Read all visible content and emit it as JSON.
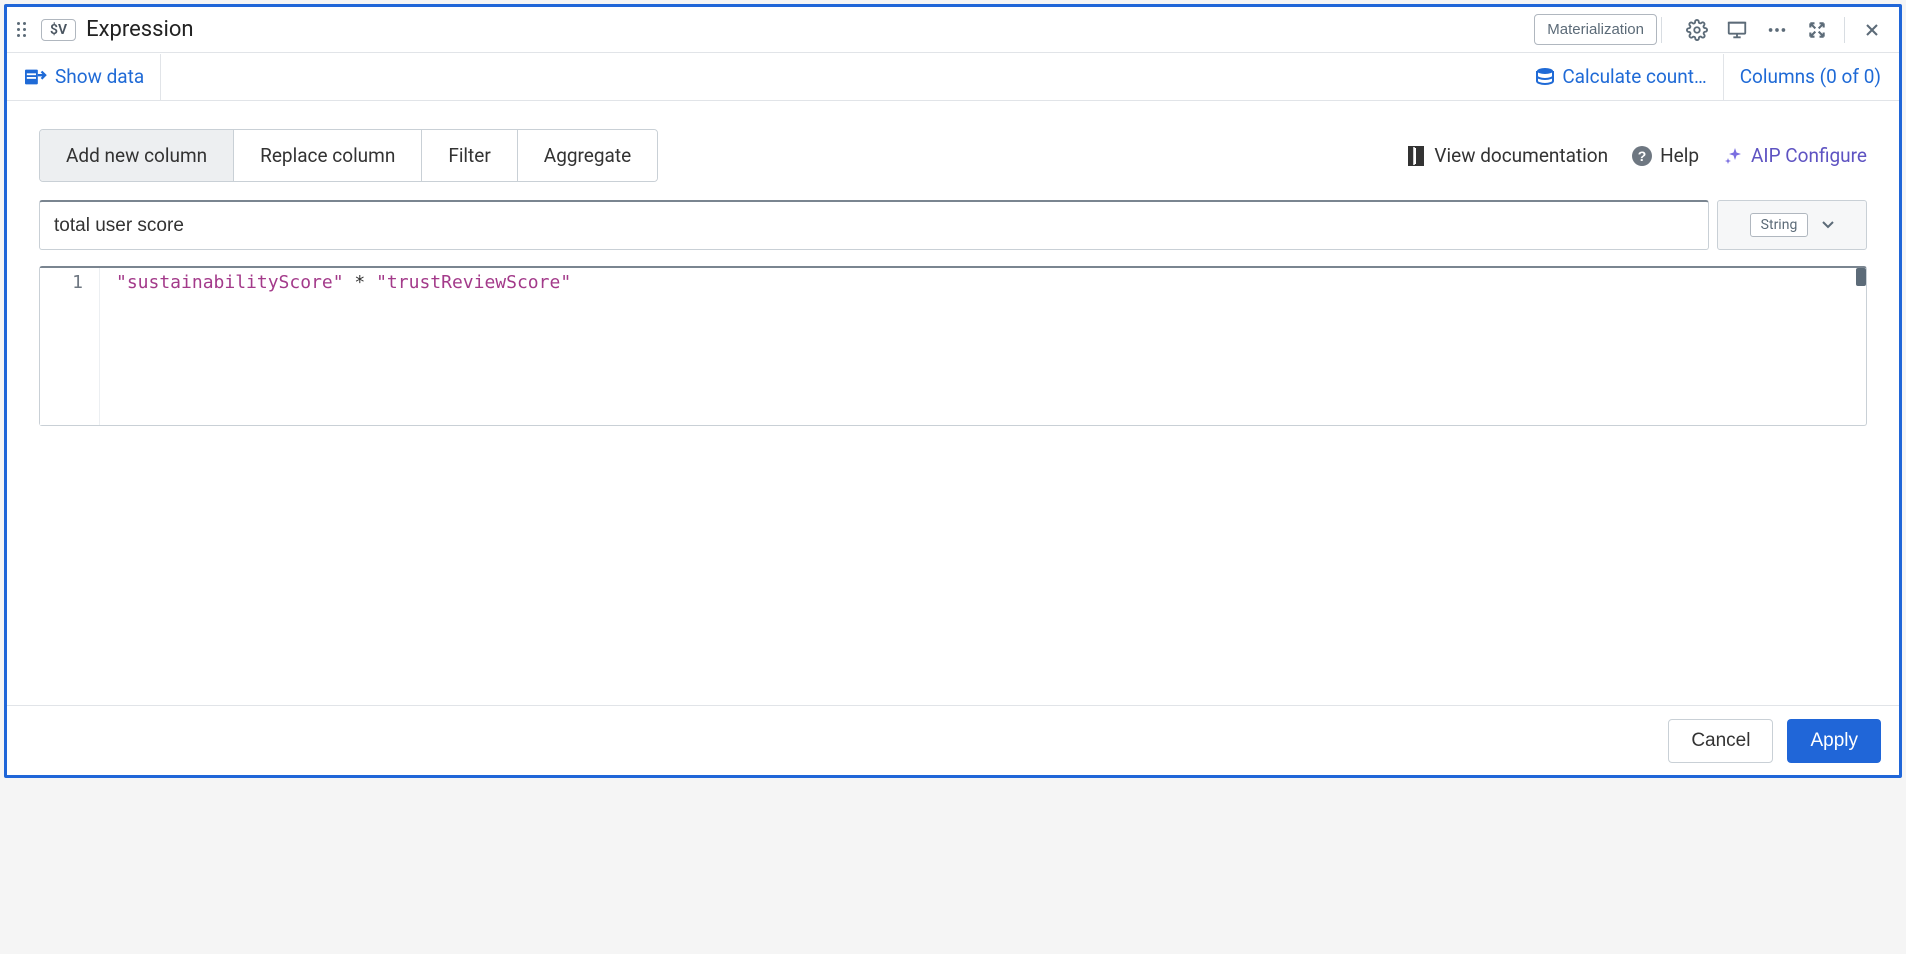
{
  "header": {
    "badge": "$V",
    "title": "Expression",
    "materialization_label": "Materialization"
  },
  "toolbar": {
    "show_data_label": "Show data",
    "calculate_label": "Calculate count…",
    "columns_label": "Columns (0 of 0)"
  },
  "tabs": {
    "items": [
      {
        "label": "Add new column"
      },
      {
        "label": "Replace column"
      },
      {
        "label": "Filter"
      },
      {
        "label": "Aggregate"
      }
    ]
  },
  "actions": {
    "view_docs": "View documentation",
    "help": "Help",
    "aip": "AIP Configure"
  },
  "column": {
    "name_value": "total user score",
    "type_label": "String"
  },
  "editor": {
    "line_no": "1",
    "tok1": "\"sustainabilityScore\"",
    "tok_op": " * ",
    "tok2": "\"trustReviewScore\""
  },
  "footer": {
    "cancel": "Cancel",
    "apply": "Apply"
  }
}
